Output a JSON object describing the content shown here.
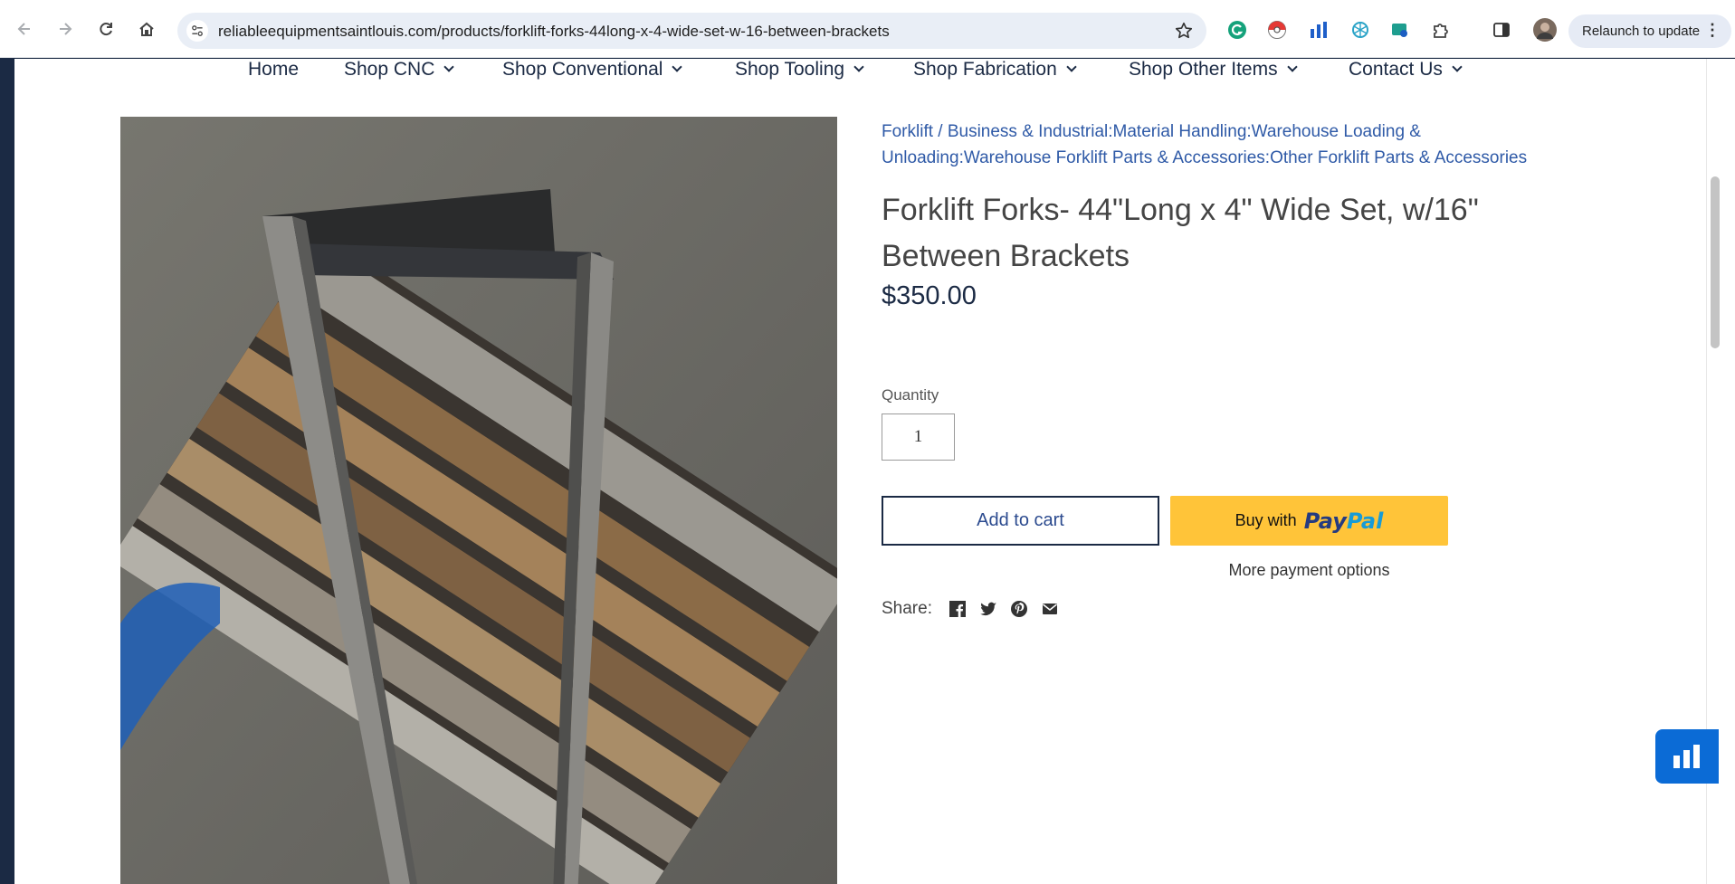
{
  "browser": {
    "url": "reliableequipmentsaintlouis.com/products/forklift-forks-44long-x-4-wide-set-w-16-between-brackets",
    "relaunch_label": "Relaunch to update",
    "icons": [
      "back-arrow-icon",
      "forward-arrow-icon",
      "reload-icon",
      "home-icon",
      "site-info-icon",
      "bookmark-star-icon",
      "grammarly-extension-icon",
      "pokeball-extension-icon",
      "chart-extension-icon",
      "openai-extension-icon",
      "pdf-extension-icon",
      "extensions-puzzle-icon",
      "side-panel-icon",
      "profile-avatar",
      "more-vert-icon"
    ]
  },
  "nav": {
    "items": [
      {
        "label": "Home"
      },
      {
        "label": "Shop CNC"
      },
      {
        "label": "Shop Conventional"
      },
      {
        "label": "Shop Tooling"
      },
      {
        "label": "Shop Fabrication"
      },
      {
        "label": "Shop Other Items"
      },
      {
        "label": "Contact Us"
      }
    ]
  },
  "product": {
    "breadcrumb": "Forklift / Business & Industrial:Material Handling:Warehouse Loading & Unloading:Warehouse Forklift Parts & Accessories:Other Forklift Parts & Accessories",
    "title": "Forklift Forks- 44\"Long x 4\" Wide Set, w/16\" Between Brackets",
    "price": "$350.00",
    "quantity_label": "Quantity",
    "quantity_value": "1",
    "add_to_cart": "Add to cart",
    "paypal_buy_text": "Buy with",
    "paypal_logo_pay": "Pay",
    "paypal_logo_pal": "Pal",
    "more_payment_options": "More payment options",
    "share_label": "Share:",
    "share_icons": [
      "facebook-icon",
      "twitter-icon",
      "pinterest-icon",
      "email-icon"
    ]
  },
  "colors": {
    "brand_navy": "#1b2a44",
    "link_blue": "#2f5aa7",
    "paypal_yellow": "#ffc439",
    "chat_blue": "#0b6bd6"
  }
}
